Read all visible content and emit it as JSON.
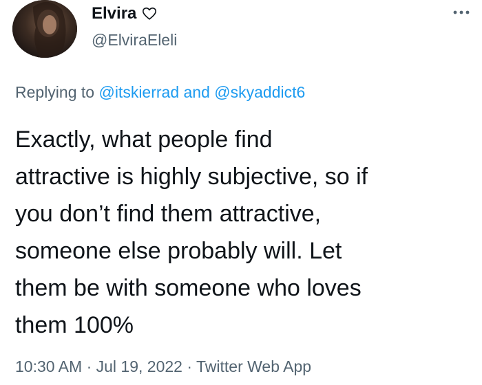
{
  "author": {
    "display_name": "Elvira",
    "handle": "@ElviraEleli"
  },
  "icons": {
    "heart": "heart-outline-icon",
    "more": "more-horizontal-icon"
  },
  "reply": {
    "prefix": "Replying to",
    "mention_1": "@itskierrad",
    "conjunction": "and",
    "mention_2": "@skyaddict6"
  },
  "body": {
    "lines": [
      "Exactly, what people find",
      "attractive is highly subjective, so if",
      "you don’t find them attractive,",
      "someone else probably will. Let",
      "them be with someone who loves",
      "them 100%"
    ]
  },
  "meta": {
    "time": "10:30 AM",
    "date": "Jul 19, 2022",
    "source": "Twitter Web App",
    "separator": "·"
  },
  "colors": {
    "text": "#0f1419",
    "secondary": "#536471",
    "link": "#1d9bf0"
  }
}
